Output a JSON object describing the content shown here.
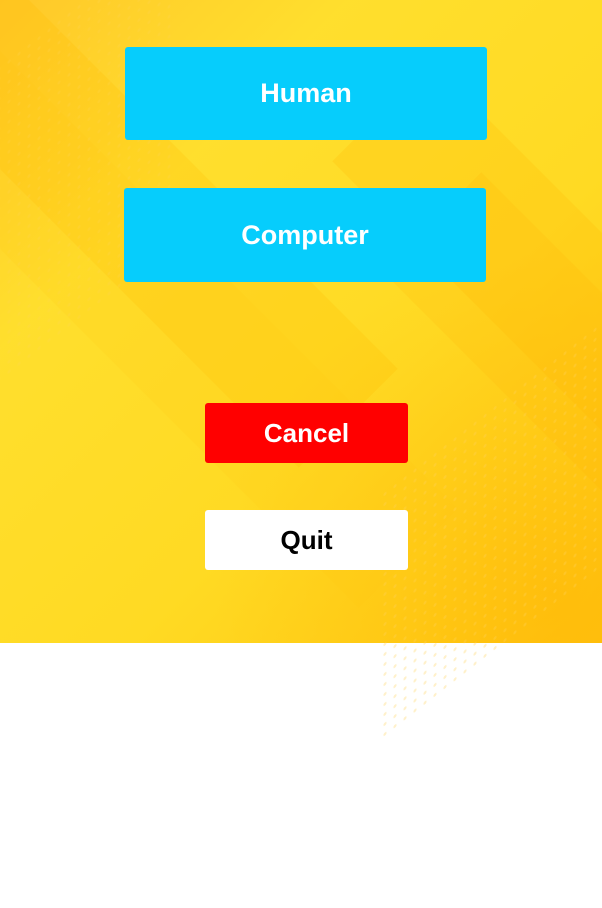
{
  "menu": {
    "human_label": "Human",
    "computer_label": "Computer",
    "cancel_label": "Cancel",
    "quit_label": "Quit"
  },
  "colors": {
    "primary_button": "#06cdfc",
    "cancel_button": "#ff0000",
    "quit_button": "#ffffff",
    "background": "#ffd91f"
  }
}
